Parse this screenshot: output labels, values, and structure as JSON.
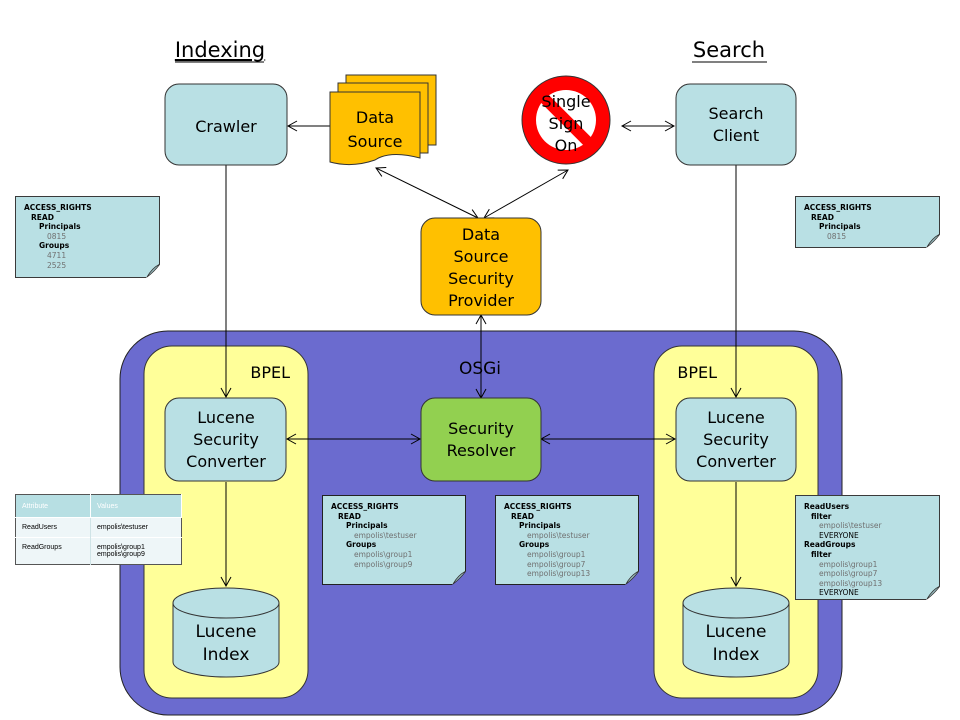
{
  "headings": {
    "indexing": "Indexing",
    "search": "Search"
  },
  "nodes": {
    "crawler": "Crawler",
    "data_source": [
      "Data",
      "Source"
    ],
    "single_sign_on": [
      "Single",
      "Sign",
      "On"
    ],
    "search_client": [
      "Search",
      "Client"
    ],
    "dssp": [
      "Data",
      "Source",
      "Security",
      "Provider"
    ],
    "osgi": "OSGi",
    "bpel_left": "BPEL",
    "bpel_right": "BPEL",
    "lsc_left": [
      "Lucene",
      "Security",
      "Converter"
    ],
    "lsc_right": [
      "Lucene",
      "Security",
      "Converter"
    ],
    "security_resolver": [
      "Security",
      "Resolver"
    ],
    "index_left": [
      "Lucene",
      "Index"
    ],
    "index_right": [
      "Lucene",
      "Index"
    ]
  },
  "notes": {
    "crawler_rights": {
      "root": "ACCESS_RIGHTS",
      "perm": "READ",
      "principals_label": "Principals",
      "principals": [
        "0815"
      ],
      "groups_label": "Groups",
      "groups": [
        "4711",
        "2525"
      ]
    },
    "client_rights": {
      "root": "ACCESS_RIGHTS",
      "perm": "READ",
      "principals_label": "Principals",
      "principals": [
        "0815"
      ]
    },
    "indexing_resolved": {
      "root": "ACCESS_RIGHTS",
      "perm": "READ",
      "principals_label": "Principals",
      "principals": [
        "empolis\\testuser"
      ],
      "groups_label": "Groups",
      "groups": [
        "empolis\\group1",
        "empolis\\group9"
      ]
    },
    "search_resolved": {
      "root": "ACCESS_RIGHTS",
      "perm": "READ",
      "principals_label": "Principals",
      "principals": [
        "empolis\\testuser"
      ],
      "groups_label": "Groups",
      "groups": [
        "empolis\\group1",
        "empolis\\group7",
        "empolis\\group13"
      ]
    },
    "query_filter": {
      "users_label": "ReadUsers",
      "users_filter_label": "filter",
      "users": [
        "empolis\\testuser"
      ],
      "users_everyone": "EVERYONE",
      "groups_label": "ReadGroups",
      "groups_filter_label": "filter",
      "groups": [
        "empolis\\group1",
        "empolis\\group7",
        "empolis\\group13"
      ],
      "groups_everyone": "EVERYONE"
    }
  },
  "index_table": {
    "headers": [
      "Attribute",
      "Values"
    ],
    "rows": [
      {
        "attribute": "ReadUsers",
        "values": [
          "empolis\\testuser"
        ]
      },
      {
        "attribute": "ReadGroups",
        "values": [
          "empolis\\group1",
          "empolis\\group9"
        ]
      }
    ]
  },
  "colors": {
    "osgi_bg": "#6b6bcf",
    "bpel_bg": "#ffff99",
    "component": "#b9e0e4",
    "provider": "#ffc000",
    "resolver": "#92d050",
    "no_sign": "#ff0000"
  }
}
